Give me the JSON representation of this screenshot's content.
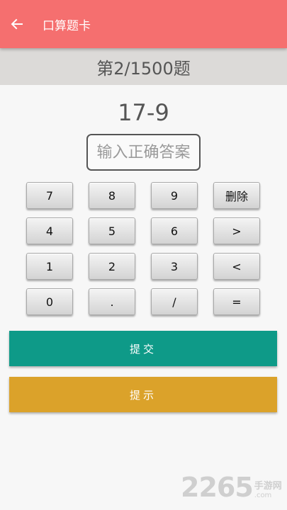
{
  "appbar": {
    "title": "口算题卡",
    "back_icon": "arrow-left-icon"
  },
  "progress": {
    "text": "第2/1500题",
    "current": 2,
    "total": 1500
  },
  "question": {
    "expression": "17-9"
  },
  "answer": {
    "value": "",
    "placeholder": "输入正确答案"
  },
  "keypad": {
    "keys": [
      "7",
      "8",
      "9",
      "删除",
      "4",
      "5",
      "6",
      ">",
      "1",
      "2",
      "3",
      "<",
      "0",
      ".",
      "/",
      "="
    ]
  },
  "buttons": {
    "submit_label": "提交",
    "hint_label": "提示"
  },
  "watermark": {
    "number": "2265",
    "cn": "手游网",
    "en": ".com"
  },
  "colors": {
    "appbar": "#f56f6f",
    "progress_bg": "#dcdad8",
    "submit": "#0e9a88",
    "hint": "#dba22a"
  }
}
